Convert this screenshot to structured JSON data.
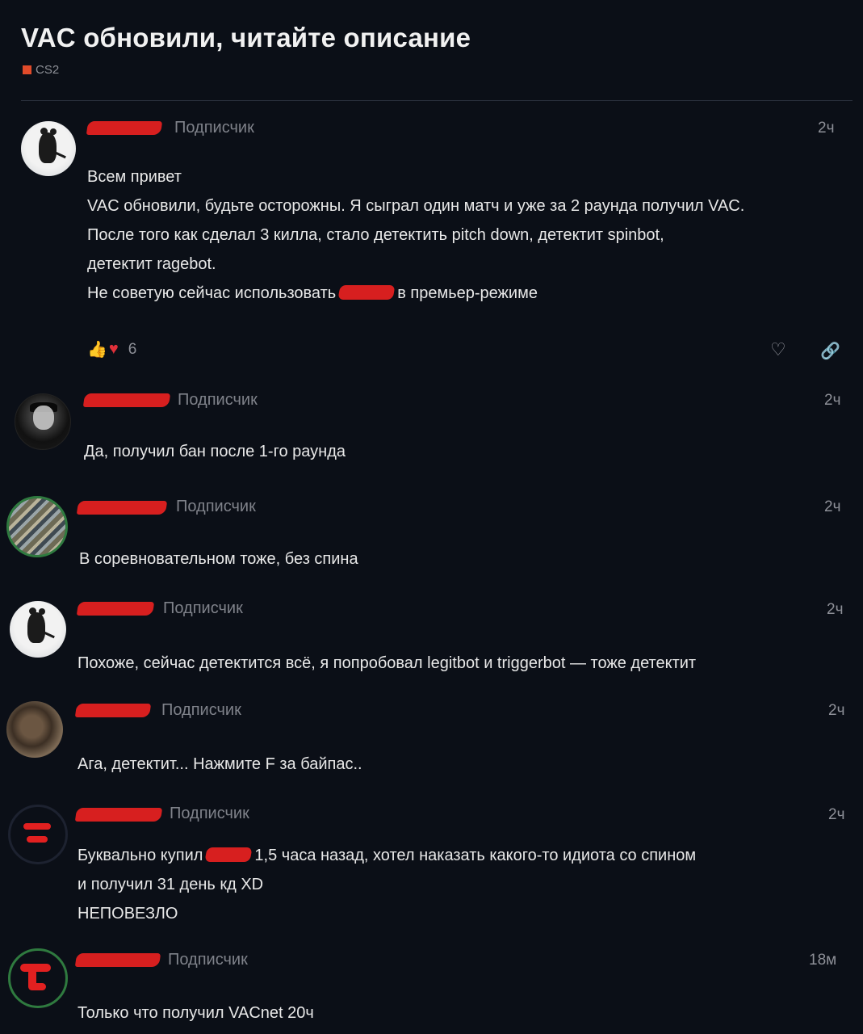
{
  "topic": {
    "title": "VAC обновили, читайте описание",
    "category": "CS2",
    "category_color": "#e14b2a"
  },
  "posts": [
    {
      "role": "Подписчик",
      "time": "2ч",
      "lines": [
        "Всем привет",
        "VAC обновили, будьте осторожны. Я сыграл один матч и уже за 2 раунда получил VAC.",
        "После того как сделал 3 килла, стало детектить pitch down, детектит spinbot,",
        "детектит ragebot."
      ],
      "line5_before": "Не советую сейчас использовать",
      "line5_after": "в премьер-режиме",
      "reaction_count": "6"
    },
    {
      "role": "Подписчик",
      "time": "2ч",
      "text": "Да, получил бан после 1-го раунда"
    },
    {
      "role": "Подписчик",
      "time": "2ч",
      "text": "В соревновательном тоже, без спина"
    },
    {
      "role": "Подписчик",
      "time": "2ч",
      "text": "Похоже, сейчас детектится всё, я попробовал legitbot и triggerbot — тоже детектит"
    },
    {
      "role": "Подписчик",
      "time": "2ч",
      "text": "Ага, детектит... Нажмите F за байпас.."
    },
    {
      "role": "Подписчик",
      "time": "2ч",
      "line1_before": "Буквально купил",
      "line1_after": "1,5 часа назад, хотел наказать какого-то идиота со спином",
      "line2": "и получил 31 день кд XD",
      "line3": "НЕПОВЕЗЛО"
    },
    {
      "role": "Подписчик",
      "time": "18м",
      "text": "Только что получил VACnet 20ч"
    }
  ],
  "icons": {
    "like": "thumbs-up-icon",
    "love": "heart-icon",
    "favorite": "heart-outline-icon",
    "share": "link-icon"
  },
  "colors": {
    "redaction": "#d71f1f",
    "background": "#0b0f17"
  }
}
